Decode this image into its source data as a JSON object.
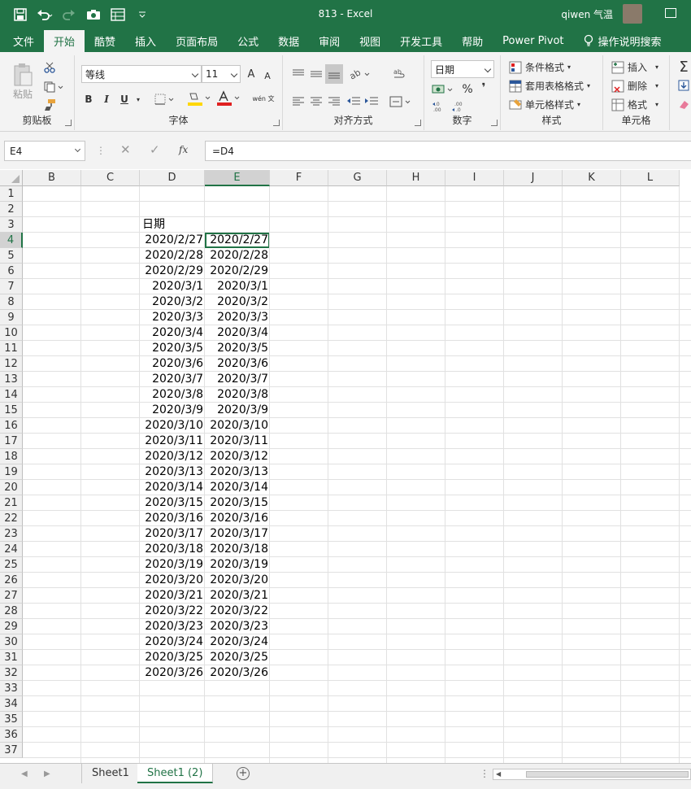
{
  "window": {
    "title": "813  -  Excel",
    "user": "qiwen 气温"
  },
  "tabs": [
    {
      "label": "文件",
      "active": false
    },
    {
      "label": "开始",
      "active": true
    },
    {
      "label": "酷赞",
      "active": false
    },
    {
      "label": "插入",
      "active": false
    },
    {
      "label": "页面布局",
      "active": false
    },
    {
      "label": "公式",
      "active": false
    },
    {
      "label": "数据",
      "active": false
    },
    {
      "label": "审阅",
      "active": false
    },
    {
      "label": "视图",
      "active": false
    },
    {
      "label": "开发工具",
      "active": false
    },
    {
      "label": "帮助",
      "active": false
    },
    {
      "label": "Power Pivot",
      "active": false
    }
  ],
  "search_label": "操作说明搜索",
  "ribbon": {
    "clipboard": {
      "label": "剪贴板",
      "paste": "粘贴"
    },
    "font": {
      "label": "字体",
      "name": "等线",
      "size": "11",
      "bold": "B",
      "italic": "I",
      "underline": "U",
      "grow": "A",
      "shrink": "A",
      "color_a": "A",
      "wen": "wén 文"
    },
    "align": {
      "label": "对齐方式"
    },
    "number": {
      "label": "数字",
      "format": "日期",
      "percent": "%",
      "comma": "❜"
    },
    "styles": {
      "label": "样式",
      "cond": "条件格式",
      "table": "套用表格格式",
      "cell": "单元格样式"
    },
    "cells": {
      "label": "单元格",
      "insert": "插入",
      "delete": "删除",
      "format": "格式"
    },
    "editing": {
      "sigma": "Σ"
    }
  },
  "formula_bar": {
    "name_box": "E4",
    "fx": "fx",
    "formula": "=D4"
  },
  "columns": [
    "B",
    "C",
    "D",
    "E",
    "F",
    "G",
    "H",
    "I",
    "J",
    "K",
    "L"
  ],
  "rows": [
    "1",
    "2",
    "3",
    "4",
    "5",
    "6",
    "7",
    "8",
    "9",
    "10",
    "11",
    "12",
    "13",
    "14",
    "15",
    "16",
    "17",
    "18",
    "19",
    "20",
    "21",
    "22",
    "23",
    "24",
    "25",
    "26",
    "27",
    "28",
    "29",
    "30",
    "31",
    "32",
    "33",
    "34",
    "35",
    "36",
    "37"
  ],
  "header_d3": "日期",
  "dates": [
    "2020/2/27",
    "2020/2/28",
    "2020/2/29",
    "2020/3/1",
    "2020/3/2",
    "2020/3/3",
    "2020/3/4",
    "2020/3/5",
    "2020/3/6",
    "2020/3/7",
    "2020/3/8",
    "2020/3/9",
    "2020/3/10",
    "2020/3/11",
    "2020/3/12",
    "2020/3/13",
    "2020/3/14",
    "2020/3/15",
    "2020/3/16",
    "2020/3/17",
    "2020/3/18",
    "2020/3/19",
    "2020/3/20",
    "2020/3/21",
    "2020/3/22",
    "2020/3/23",
    "2020/3/24",
    "2020/3/25",
    "2020/3/26"
  ],
  "selected": {
    "column": "E",
    "row": "4"
  },
  "sheets": [
    {
      "label": "Sheet1",
      "active": false
    },
    {
      "label": "Sheet1 (2)",
      "active": true
    }
  ],
  "colors": {
    "accent": "#217346",
    "highlight": "#ffd700",
    "font_red": "#e02020"
  }
}
